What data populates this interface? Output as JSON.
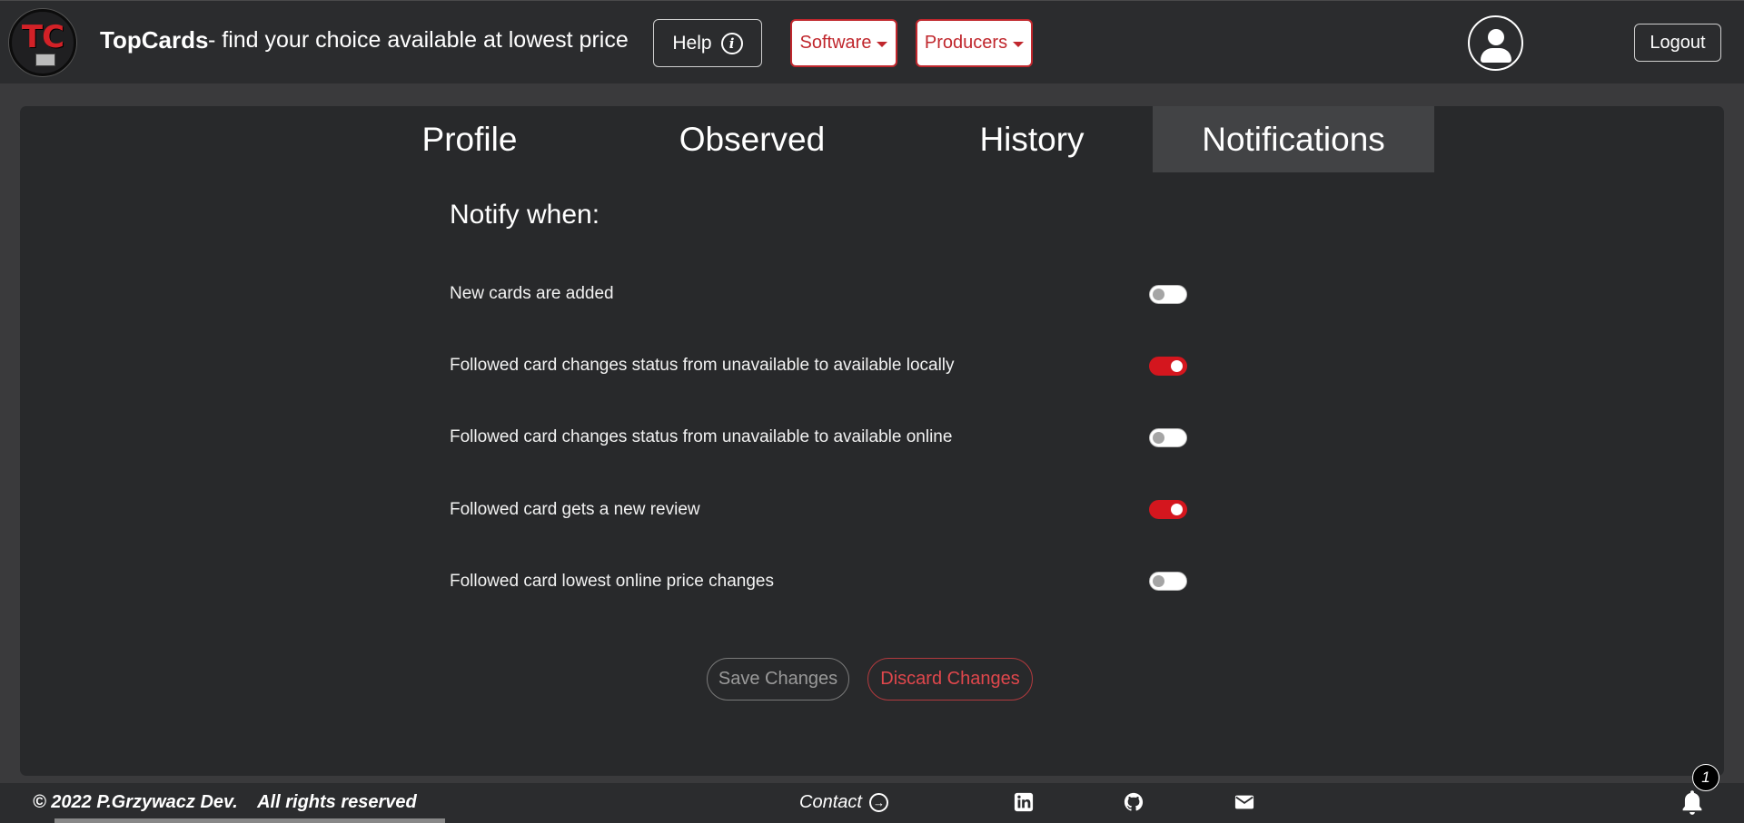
{
  "navbar": {
    "logo_text": "TC",
    "brand": "TopCards",
    "tagline": "- find your choice available at lowest price",
    "help_label": "Help",
    "software_label": "Software",
    "producers_label": "Producers",
    "logout_label": "Logout"
  },
  "tabs": [
    {
      "label": "Profile",
      "active": false
    },
    {
      "label": "Observed",
      "active": false
    },
    {
      "label": "History",
      "active": false
    },
    {
      "label": "Notifications",
      "active": true
    }
  ],
  "notifications": {
    "title": "Notify when:",
    "options": [
      {
        "label": "New cards are added",
        "enabled": false
      },
      {
        "label": "Followed card changes status from unavailable to available locally",
        "enabled": true
      },
      {
        "label": "Followed card changes status from unavailable to available online",
        "enabled": false
      },
      {
        "label": "Followed card gets a new review",
        "enabled": true
      },
      {
        "label": "Followed card lowest online price changes",
        "enabled": false
      }
    ],
    "save_label": "Save Changes",
    "discard_label": "Discard Changes"
  },
  "footer": {
    "copyright": "© 2022 P.Grzywacz Dev.    All rights reserved",
    "contact_label": "Contact",
    "notification_count": "1"
  },
  "colors": {
    "accent": "#d4161e",
    "background": "#3a3a3c",
    "panel": "#28292b"
  }
}
